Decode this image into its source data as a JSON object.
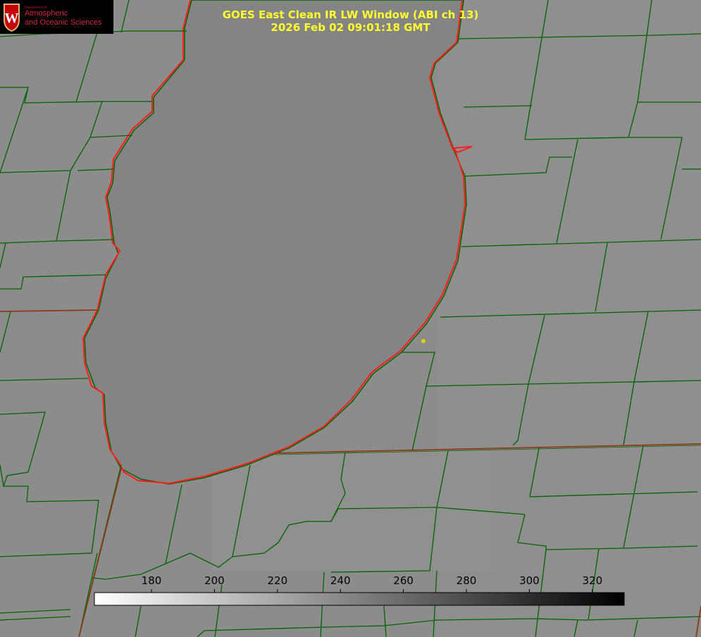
{
  "header": {
    "title_line1": "GOES East Clean IR LW Window (ABI ch 13)",
    "title_line2": "2026 Feb 02 09:01:18 GMT"
  },
  "logo": {
    "dept_label": "Department of",
    "name_line1": "Atmospheric",
    "name_line2": "and Oceanic Sciences",
    "seal_letter": "W"
  },
  "colorbar": {
    "ticks": [
      "180",
      "200",
      "220",
      "240",
      "260",
      "280",
      "300",
      "320"
    ],
    "colors": {
      "low": "#ffffff",
      "high": "#000000"
    }
  },
  "map_colors": {
    "background": "#8c8c8c",
    "lake": "#858585",
    "county_lines": "#006400",
    "shoreline": "#ff2020",
    "marker": "#e0d000"
  }
}
